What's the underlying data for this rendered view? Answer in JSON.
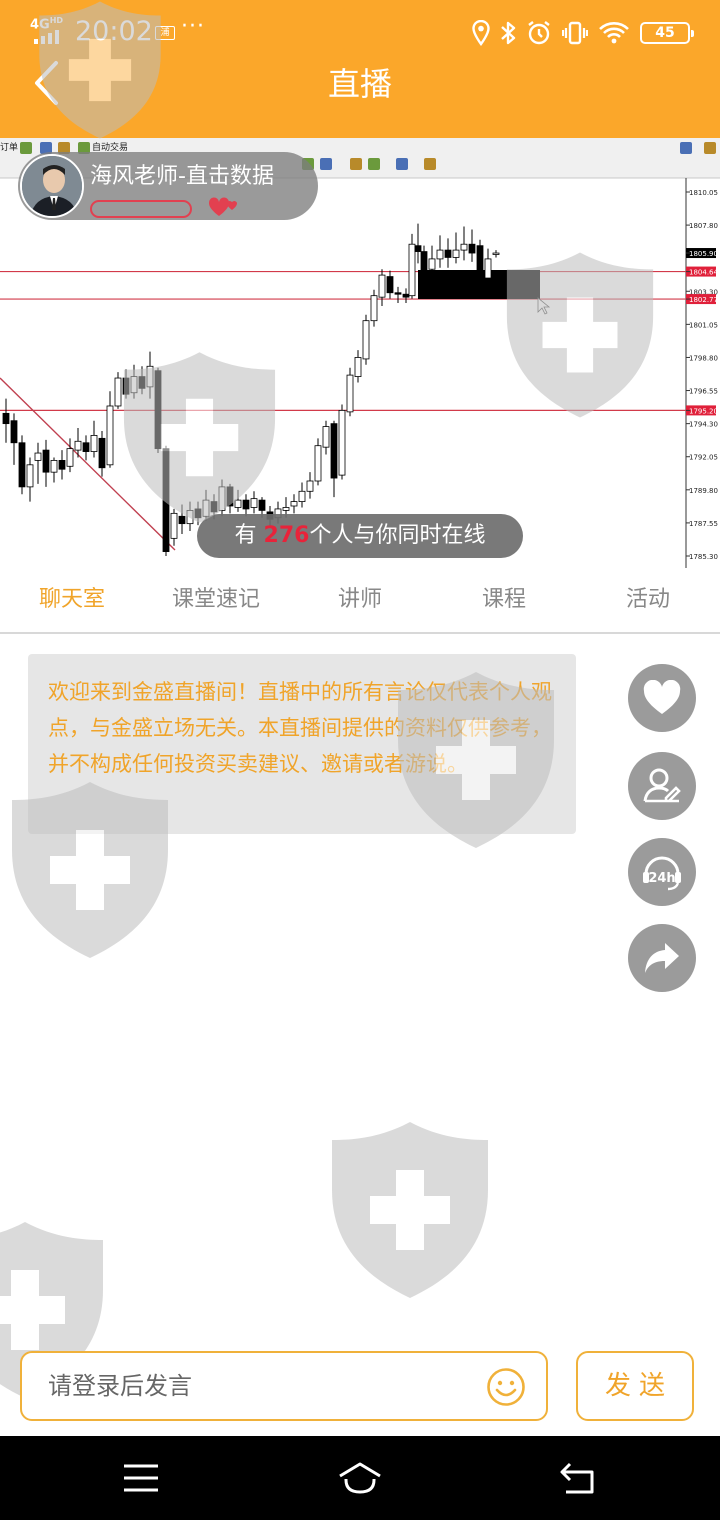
{
  "status_bar": {
    "network": "4G",
    "network_sup": "HD",
    "time": "20:02",
    "badge": "浦",
    "more": "···",
    "battery": "45"
  },
  "header": {
    "title": "直播",
    "back_icon": "chevron-left-icon"
  },
  "video": {
    "teacher_name": "海风老师-直击数据",
    "online_prefix": "有",
    "online_count": "276",
    "online_suffix": "个人与你同时在线",
    "toolbar_label": "自动交易",
    "toolbar_fragment": "订单",
    "price_ticks": [
      "1810.05",
      "1807.80",
      "1805.90",
      "1804.64",
      "1803.30",
      "1802.77",
      "1801.05",
      "1798.80",
      "1796.55",
      "1795.20",
      "1794.30",
      "1792.05",
      "1789.80",
      "1787.55",
      "1785.30"
    ]
  },
  "tabs": [
    {
      "label": "聊天室",
      "active": true
    },
    {
      "label": "课堂速记",
      "active": false
    },
    {
      "label": "讲师",
      "active": false
    },
    {
      "label": "课程",
      "active": false
    },
    {
      "label": "活动",
      "active": false
    }
  ],
  "chat": {
    "notice": "欢迎来到金盛直播间！直播中的所有言论仅代表个人观点，与金盛立场无关。本直播间提供的资料仅供参考，并不构成任何投资买卖建议、邀请或者游说。"
  },
  "side_buttons": [
    "heart-icon",
    "user-edit-icon",
    "support-24h-icon",
    "share-icon"
  ],
  "input": {
    "placeholder": "请登录后发言",
    "send_label": "发送"
  },
  "colors": {
    "accent": "#FBA72A",
    "tab_active": "#F0A42A",
    "online_number": "#E8233A"
  }
}
